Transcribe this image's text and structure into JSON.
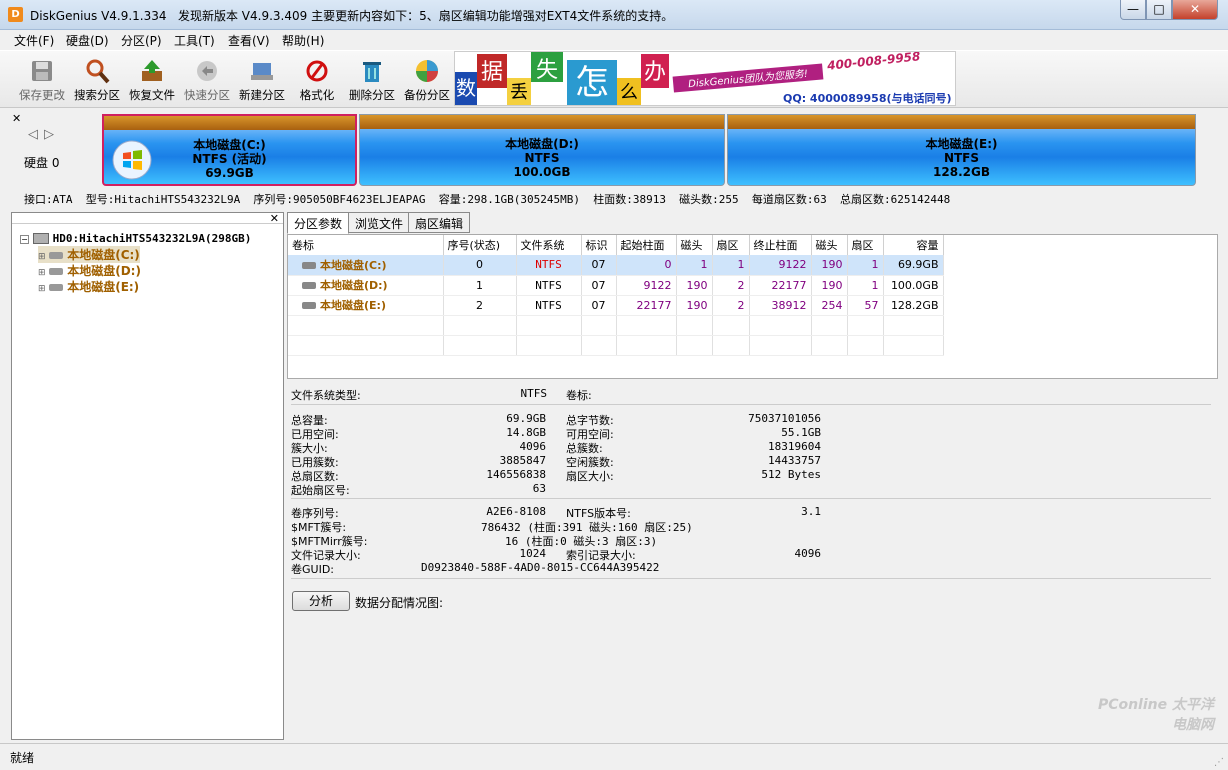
{
  "window": {
    "title": "DiskGenius V4.9.1.334",
    "notice": "发现新版本 V4.9.3.409 主要更新内容如下：5、扇区编辑功能增强对EXT4文件系统的支持。",
    "min": "—",
    "max": "□",
    "close": "✕"
  },
  "menu": [
    "文件(F)",
    "硬盘(D)",
    "分区(P)",
    "工具(T)",
    "查看(V)",
    "帮助(H)"
  ],
  "toolbar": [
    {
      "label": "保存更改",
      "icon": "save-icon"
    },
    {
      "label": "搜索分区",
      "icon": "magnifier-icon"
    },
    {
      "label": "恢复文件",
      "icon": "recover-icon"
    },
    {
      "label": "快速分区",
      "icon": "quick-partition-icon"
    },
    {
      "label": "新建分区",
      "icon": "new-partition-icon"
    },
    {
      "label": "格式化",
      "icon": "format-icon"
    },
    {
      "label": "删除分区",
      "icon": "delete-icon"
    },
    {
      "label": "备份分区",
      "icon": "backup-icon"
    }
  ],
  "banner": {
    "chars": [
      "数",
      "据",
      "丢",
      "失",
      "怎",
      "么",
      "办"
    ],
    "slogan": "DiskGenius团队为您服务!",
    "phone": "400-008-9958",
    "qq": "QQ: 4000089958(与电话同号)"
  },
  "disk": {
    "label": "硬盘 0",
    "partitions": [
      {
        "name": "本地磁盘(C:)",
        "fs": "NTFS (活动)",
        "size": "69.9GB"
      },
      {
        "name": "本地磁盘(D:)",
        "fs": "NTFS",
        "size": "100.0GB"
      },
      {
        "name": "本地磁盘(E:)",
        "fs": "NTFS",
        "size": "128.2GB"
      }
    ],
    "info": "接口:ATA  型号:HitachiHTS543232L9A  序列号:905050BF4623ELJEAPAG  容量:298.1GB(305245MB)  柱面数:38913  磁头数:255  每道扇区数:63  总扇区数:625142448"
  },
  "tree": {
    "root": "HD0:HitachiHTS543232L9A(298GB)",
    "items": [
      "本地磁盘(C:)",
      "本地磁盘(D:)",
      "本地磁盘(E:)"
    ]
  },
  "tabs": [
    "分区参数",
    "浏览文件",
    "扇区编辑"
  ],
  "table": {
    "headers": [
      "卷标",
      "序号(状态)",
      "文件系统",
      "标识",
      "起始柱面",
      "磁头",
      "扇区",
      "终止柱面",
      "磁头",
      "扇区",
      "容量"
    ],
    "rows": [
      [
        "本地磁盘(C:)",
        "0",
        "NTFS",
        "07",
        "0",
        "1",
        "1",
        "9122",
        "190",
        "1",
        "69.9GB"
      ],
      [
        "本地磁盘(D:)",
        "1",
        "NTFS",
        "07",
        "9122",
        "190",
        "2",
        "22177",
        "190",
        "1",
        "100.0GB"
      ],
      [
        "本地磁盘(E:)",
        "2",
        "NTFS",
        "07",
        "22177",
        "190",
        "2",
        "38912",
        "254",
        "57",
        "128.2GB"
      ]
    ]
  },
  "details": {
    "fs_type_label": "文件系统类型:",
    "fs_type": "NTFS",
    "vol_label": "卷标:",
    "left1": [
      [
        "总容量:",
        "69.9GB"
      ],
      [
        "已用空间:",
        "14.8GB"
      ],
      [
        "簇大小:",
        "4096"
      ],
      [
        "已用簇数:",
        "3885847"
      ],
      [
        "总扇区数:",
        "146556838"
      ],
      [
        "起始扇区号:",
        "63"
      ]
    ],
    "right1": [
      [
        "总字节数:",
        "75037101056"
      ],
      [
        "可用空间:",
        "55.1GB"
      ],
      [
        "总簇数:",
        "18319604"
      ],
      [
        "空闲簇数:",
        "14433757"
      ],
      [
        "扇区大小:",
        "512 Bytes"
      ]
    ],
    "left2": [
      [
        "卷序列号:",
        "A2E6-8108"
      ],
      [
        "$MFT簇号:",
        "786432 (柱面:391 磁头:160 扇区:25)"
      ],
      [
        "$MFTMirr簇号:",
        "16 (柱面:0 磁头:3 扇区:3)"
      ],
      [
        "文件记录大小:",
        "1024"
      ],
      [
        "卷GUID:",
        "D0923840-588F-4AD0-8015-CC644A395422"
      ]
    ],
    "right2": [
      [
        "NTFS版本号:",
        "3.1"
      ],
      [
        "",
        ""
      ],
      [
        "",
        ""
      ],
      [
        "索引记录大小:",
        "4096"
      ]
    ],
    "analyze": "分析",
    "alloc": "数据分配情况图:"
  },
  "status": "就绪",
  "watermark": "PConline 太平洋电脑网"
}
